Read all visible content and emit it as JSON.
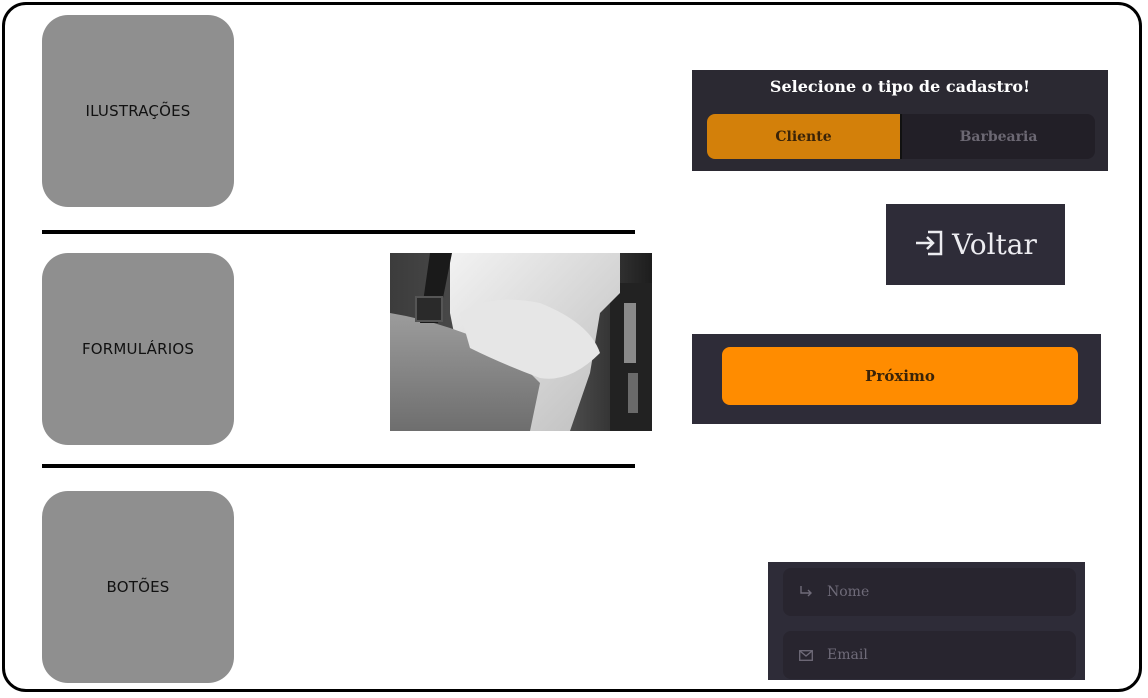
{
  "sections": {
    "illustrations": "ILUSTRAÇÕES",
    "forms": "FORMULÁRIOS",
    "buttons": "BOTÕES"
  },
  "signup_type": {
    "title": "Selecione o tipo de cadastro!",
    "options": [
      {
        "label": "Cliente",
        "selected": true
      },
      {
        "label": "Barbearia",
        "selected": false
      }
    ]
  },
  "voltar": {
    "label": "Voltar",
    "icon": "sign-in-icon"
  },
  "proximo": {
    "label": "Próximo"
  },
  "form": {
    "name": {
      "placeholder": "Nome",
      "value": "",
      "icon": "arrow-turn-right-icon"
    },
    "email": {
      "placeholder": "Email",
      "value": "",
      "icon": "envelope-icon"
    }
  },
  "colors": {
    "accent": "#ff8c00",
    "accent_dark": "#d3800a",
    "panel": "#2e2c38",
    "section_box": "#8f8f8f"
  }
}
